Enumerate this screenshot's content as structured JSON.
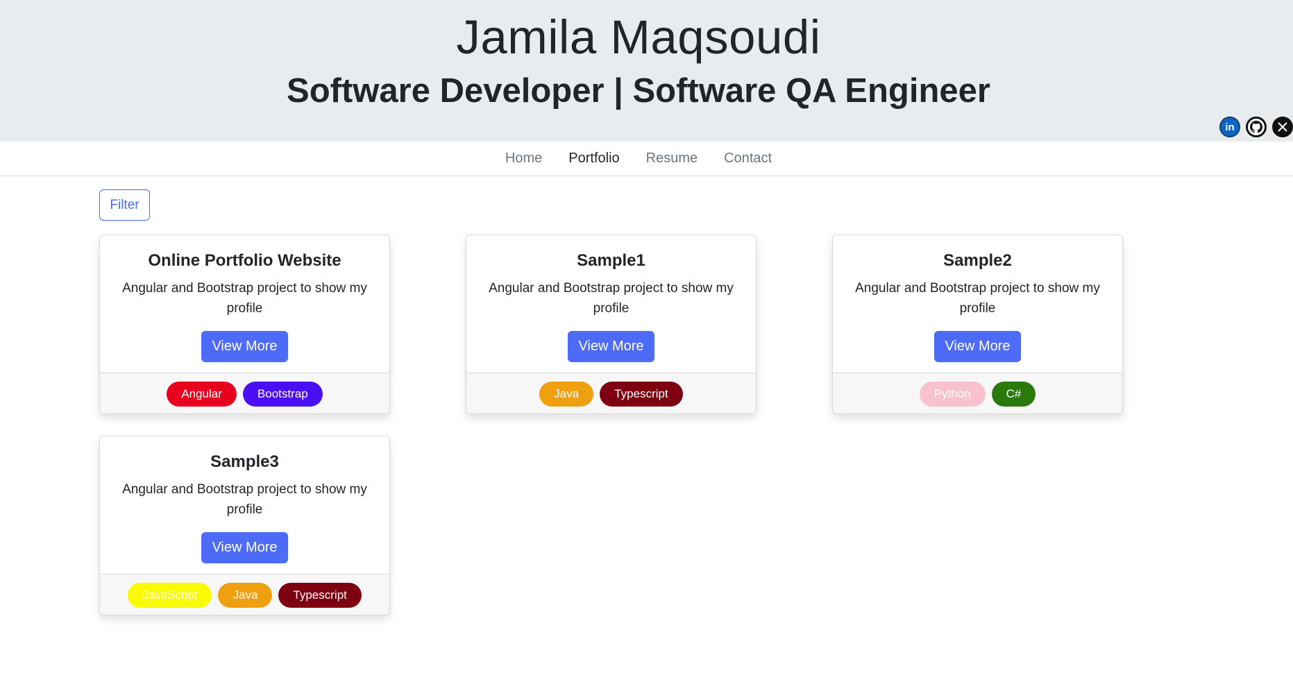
{
  "header": {
    "name": "Jamila Maqsoudi",
    "role": "Software Developer | Software QA Engineer",
    "socials": [
      {
        "icon": "linkedin-icon",
        "glyph": "in"
      },
      {
        "icon": "github-icon",
        "glyph": "●"
      },
      {
        "icon": "x-icon",
        "glyph": "𝕏"
      }
    ]
  },
  "nav": {
    "items": [
      "Home",
      "Portfolio",
      "Resume",
      "Contact"
    ],
    "active": "Portfolio"
  },
  "filter": {
    "label": "Filter"
  },
  "cards": [
    {
      "title": "Online Portfolio Website",
      "description": "Angular and Bootstrap project to show my profile",
      "button": "View More",
      "tags": [
        {
          "label": "Angular",
          "color": "#e8001f"
        },
        {
          "label": "Bootstrap",
          "color": "#4a0ff5"
        }
      ]
    },
    {
      "title": "Sample1",
      "description": "Angular and Bootstrap project to show my profile",
      "button": "View More",
      "tags": [
        {
          "label": "Java",
          "color": "#eea011"
        },
        {
          "label": "Typescript",
          "color": "#7e0010"
        }
      ]
    },
    {
      "title": "Sample2",
      "description": "Angular and Bootstrap project to show my profile",
      "button": "View More",
      "tags": [
        {
          "label": "Python",
          "color": "#f7c2cd"
        },
        {
          "label": "C#",
          "color": "#2a7a0b"
        }
      ]
    },
    {
      "title": "Sample3",
      "description": "Angular and Bootstrap project to show my profile",
      "button": "View More",
      "tags": [
        {
          "label": "JavaScript",
          "color": "#fbfb00"
        },
        {
          "label": "Java",
          "color": "#eea011"
        },
        {
          "label": "Typescript",
          "color": "#7e0010"
        }
      ]
    }
  ],
  "colors": {
    "primary": "#4d6bf7",
    "header_bg": "#e9ecef"
  }
}
